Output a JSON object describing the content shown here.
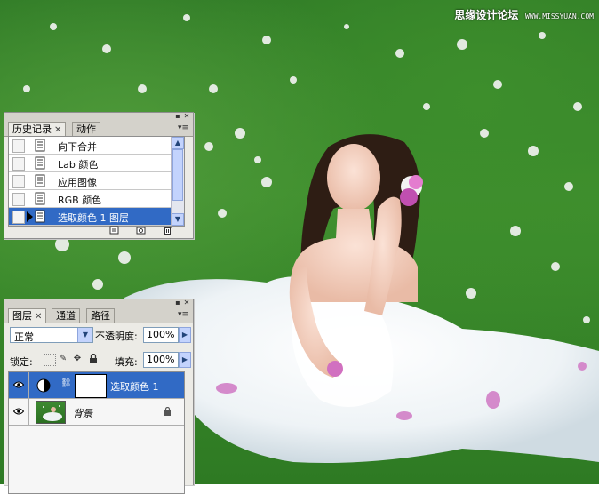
{
  "watermark": {
    "text": "思缘设计论坛",
    "url": "WWW.MISSYUAN.COM"
  },
  "history_panel": {
    "tabs": [
      {
        "label": "历史记录",
        "active": true,
        "closable": true
      },
      {
        "label": "动作",
        "active": false,
        "closable": false
      }
    ],
    "items": [
      {
        "label": "向下合并",
        "selected": false
      },
      {
        "label": "Lab 颜色",
        "selected": false
      },
      {
        "label": "应用图像",
        "selected": false
      },
      {
        "label": "RGB 颜色",
        "selected": false
      },
      {
        "label": "选取颜色 1 图层",
        "selected": true
      }
    ],
    "bottom_icons": [
      "new-document-icon",
      "new-snapshot-icon",
      "trash-icon"
    ]
  },
  "layers_panel": {
    "tabs": [
      {
        "label": "图层",
        "active": true,
        "closable": true
      },
      {
        "label": "通道",
        "active": false,
        "closable": false
      },
      {
        "label": "路径",
        "active": false,
        "closable": false
      }
    ],
    "blend_mode": "正常",
    "opacity_label": "不透明度:",
    "opacity_value": "100%",
    "lock_label": "锁定:",
    "fill_label": "填充:",
    "fill_value": "100%",
    "layers": [
      {
        "name": "选取颜色 1",
        "type": "adjustment",
        "selected": true,
        "visible": true
      },
      {
        "name": "背景",
        "type": "image",
        "selected": false,
        "visible": true,
        "locked": true
      }
    ]
  },
  "colors": {
    "selection": "#316ac5",
    "panel_bg": "#ecebe6"
  }
}
